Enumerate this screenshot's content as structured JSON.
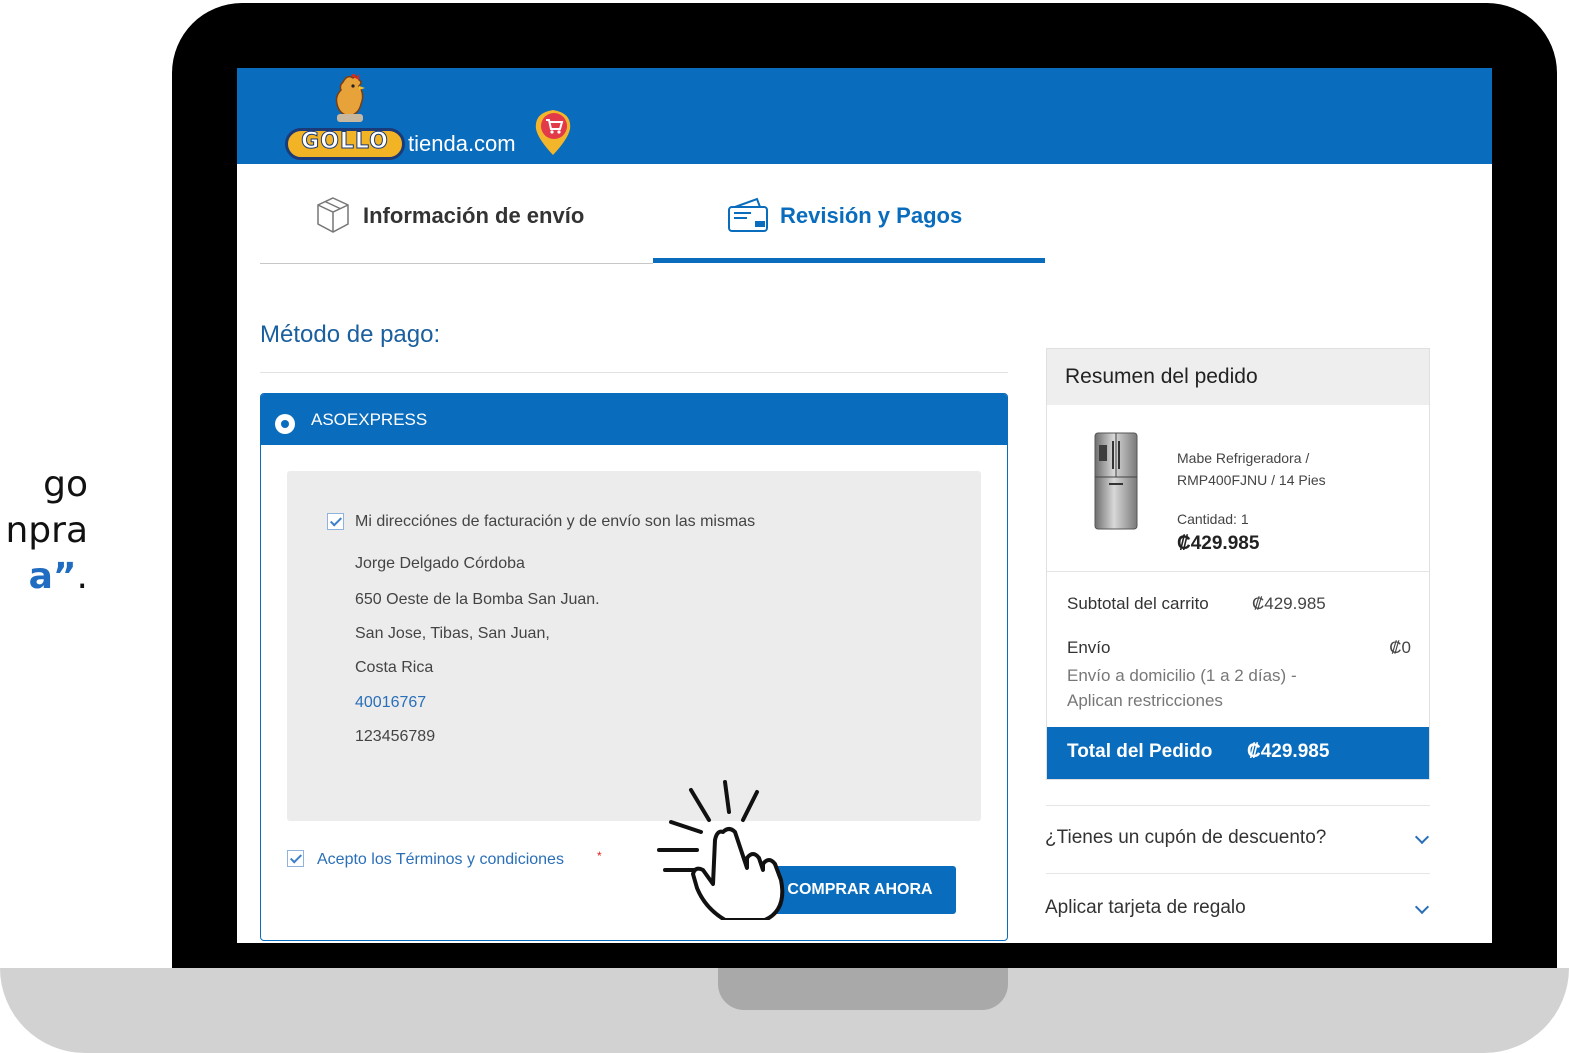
{
  "caption": {
    "line1": "go",
    "line2": "npra",
    "line3_highlight": "a”",
    "line3_end": "."
  },
  "header": {
    "logo_brand": "GOLLO",
    "logo_site": "tienda.com"
  },
  "tabs": [
    {
      "label": "Información de envío",
      "icon": "package-icon",
      "active": false
    },
    {
      "label": "Revisión y Pagos",
      "icon": "wallet-icon",
      "active": true
    }
  ],
  "payment": {
    "title": "Método de pago:",
    "method_name": "ASOEXPRESS",
    "same_address_label": "Mi direcciónes de facturación y de envío son las mismas",
    "same_address_checked": true,
    "address": {
      "name": "Jorge Delgado Córdoba",
      "street": "650 Oeste de la Bomba San Juan.",
      "city": "San Jose, Tibas, San Juan,",
      "country": "Costa Rica",
      "phone": "40016767",
      "id_number": "123456789"
    },
    "terms_label": "Acepto los Términos y condiciones",
    "terms_required_mark": "*",
    "terms_checked": true,
    "buy_button": "COMPRAR AHORA"
  },
  "summary": {
    "title": "Resumen del pedido",
    "product_name": "Mabe Refrigeradora / RMP400FJNU / 14 Pies",
    "quantity": "Cantidad: 1",
    "product_price": "₡429.985",
    "subtotal_label": "Subtotal del carrito",
    "subtotal_value": "₡429.985",
    "shipping_label": "Envío",
    "shipping_value": "₡0",
    "shipping_note": "Envío a domicilio (1 a 2 días) - Aplican restricciones",
    "total_label": "Total del Pedido",
    "total_value": "₡429.985"
  },
  "accordions": [
    {
      "label": "¿Tienes un cupón de descuento?"
    },
    {
      "label": "Aplicar tarjeta de regalo"
    }
  ],
  "colors": {
    "brand_blue": "#0a6cbd",
    "caption_blue": "#1f6cc0"
  }
}
